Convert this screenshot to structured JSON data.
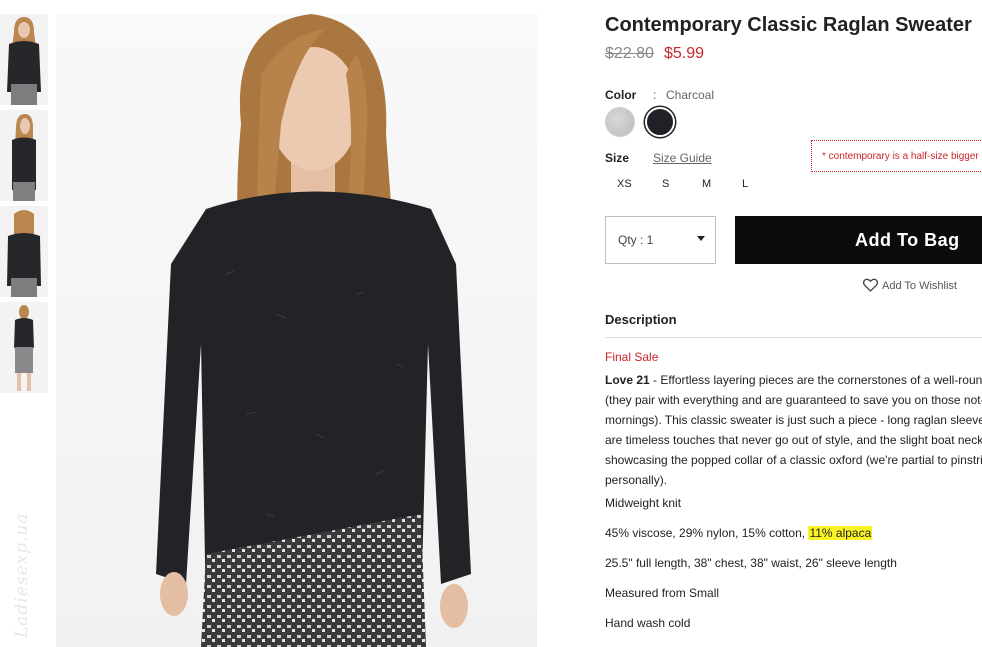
{
  "product": {
    "title": "Contemporary Classic Raglan Sweater",
    "price_original": "$22.80",
    "price_sale": "$5.99"
  },
  "color": {
    "label": "Color",
    "separator": ":",
    "selected": "Charcoal",
    "swatches": [
      "grey",
      "charcoal"
    ]
  },
  "size": {
    "label": "Size",
    "guide_link": "Size Guide",
    "options": [
      "XS",
      "S",
      "M",
      "L"
    ],
    "note": "* contemporary is a half-size bigger"
  },
  "qty": {
    "label": "Qty : 1"
  },
  "actions": {
    "add_to_bag": "Add To Bag",
    "wishlist": "Add To Wishlist"
  },
  "description": {
    "heading": "Description",
    "final_sale": "Final Sale",
    "brand": "Love 21",
    "lines": [
      " - Effortless layering pieces are the cornerstones of a well-rounded wardrobe",
      "(they pair with everything and are guaranteed to save you on those not-so-chilly",
      "mornings). This classic sweater is just such a piece - long raglan sleeves",
      "are timeless touches that never go out of style, and the slight boat neckline",
      "showcasing the popped collar of a classic oxford (we're partial to pinstripes",
      "personally)."
    ],
    "fabric_weight": "Midweight knit",
    "composition_prefix": "45% viscose, 29% nylon, 15% cotton, ",
    "composition_highlight": "11% alpaca",
    "measurements": "25.5\" full length, 38\" chest, 38\" waist, 26\" sleeve length",
    "measured_from": "Measured from Small",
    "care": "Hand wash cold"
  },
  "watermark": "Ladiesexp.ua",
  "colors": {
    "accent_red": "#c9262c",
    "button_black": "#0c0c0c",
    "highlight": "#fbf425"
  },
  "icons": [
    "heart-icon",
    "caret-down-icon"
  ]
}
